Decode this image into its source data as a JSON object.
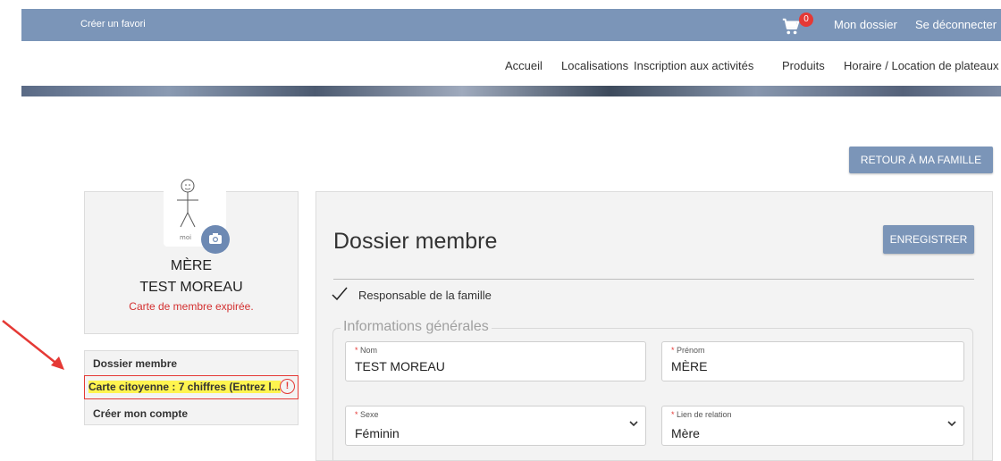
{
  "topbar": {
    "favorite_link": "Créer un favori",
    "cart_count": "0",
    "my_file_link": "Mon dossier",
    "logout_link": "Se déconnecter"
  },
  "nav": {
    "home": "Accueil",
    "locations": "Localisations",
    "activities": "Inscription aux activités",
    "products": "Produits",
    "schedule": "Horaire / Location de plateaux"
  },
  "retour_button": "RETOUR À MA FAMILLE",
  "profile": {
    "relation": "MÈRE",
    "full_name": "TEST MOREAU",
    "status": "Carte de membre expirée."
  },
  "sidebar": {
    "items": [
      {
        "label": "Dossier membre"
      },
      {
        "label": "Carte citoyenne : 7 chiffres (Entrez l..."
      },
      {
        "label": "Créer mon compte"
      }
    ]
  },
  "main": {
    "title": "Dossier membre",
    "save_button": "ENREGISTRER",
    "family_responsible": "Responsable de la famille",
    "section_title": "Informations générales",
    "fields": {
      "nom": {
        "label": "Nom",
        "value": "TEST MOREAU"
      },
      "prenom": {
        "label": "Prénom",
        "value": "MÈRE"
      },
      "sexe": {
        "label": "Sexe",
        "value": "Féminin"
      },
      "relation": {
        "label": "Lien de relation",
        "value": "Mère"
      }
    }
  },
  "colors": {
    "primary": "#7b95b8",
    "alert": "#e53935",
    "highlight": "#fff44f"
  }
}
